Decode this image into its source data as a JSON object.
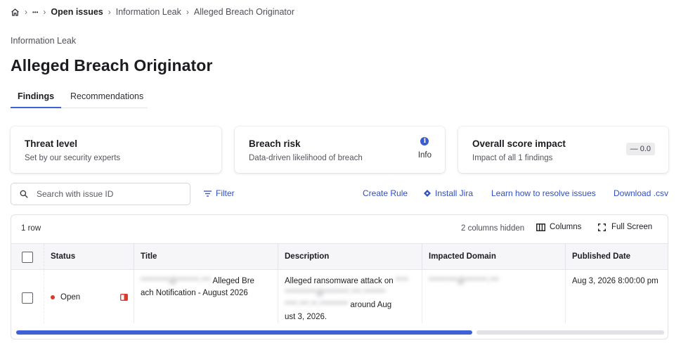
{
  "breadcrumb": {
    "home_icon": "home-icon",
    "more": "•••",
    "items": [
      "Open issues",
      "Information Leak",
      "Alleged Breach Originator"
    ]
  },
  "page": {
    "category": "Information Leak",
    "title": "Alleged Breach Originator"
  },
  "tabs": [
    {
      "label": "Findings",
      "active": true
    },
    {
      "label": "Recommendations",
      "active": false
    }
  ],
  "cards": {
    "threat": {
      "title": "Threat level",
      "subtitle": "Set by our security experts"
    },
    "breach": {
      "title": "Breach risk",
      "subtitle": "Data-driven likelihood of breach",
      "badge_icon": "info-icon",
      "badge_icon_glyph": "i",
      "badge_label": "Info"
    },
    "score": {
      "title": "Overall score impact",
      "subtitle": "Impact of all 1 findings",
      "value": "— 0.0"
    }
  },
  "toolbar": {
    "search_placeholder": "Search with issue ID",
    "filter_label": "Filter",
    "create_rule_label": "Create Rule",
    "install_jira_label": "Install Jira",
    "learn_label": "Learn how to resolve issues",
    "download_label": "Download .csv"
  },
  "table": {
    "row_count": "1 row",
    "hidden_columns": "2 columns hidden",
    "columns_button": "Columns",
    "fullscreen_button": "Full Screen",
    "headers": [
      "Status",
      "Title",
      "Description",
      "Impacted Domain",
      "Published Date"
    ],
    "rows": [
      {
        "status": "Open",
        "status_color": "#d93a2b",
        "flag_color": "#d93a2b",
        "title_redacted": "*********@*******.***",
        "title_line1": "Alleged Bre",
        "title_line2": "ach Notification - August 2026",
        "desc_line1": "Alleged ransomware attack on",
        "desc_redacted1": "****",
        "desc_redacted2": "**********@********.***.*******",
        "desc_redacted3": "****.***.**.*********",
        "desc_tail": "around Aug",
        "desc_line4": "ust 3, 2026.",
        "domain_redacted": "*********@*******.***",
        "published": "Aug 3, 2026 8:00:00 pm"
      }
    ]
  },
  "scrollbar": {
    "position_fraction": 0.0,
    "visible_fraction": 0.71
  },
  "colors": {
    "accent": "#3f61d6",
    "link": "#2f4fc2",
    "status_open": "#d93a2b"
  }
}
